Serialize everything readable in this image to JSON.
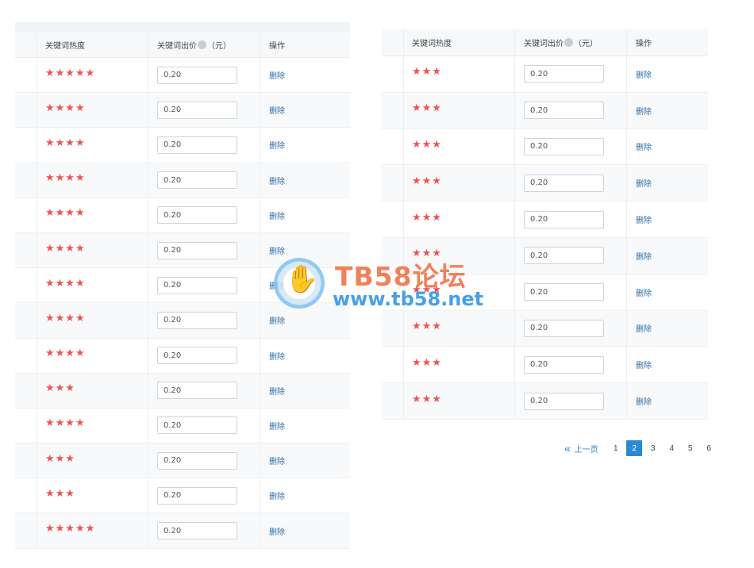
{
  "left_table": {
    "headers": {
      "heat": "关键词热度",
      "price": "关键词出价",
      "price_unit": "（元）",
      "action": "操作"
    },
    "rows": [
      {
        "stars": "★★★★★",
        "price": "0.20",
        "action": "删除"
      },
      {
        "stars": "★★★★",
        "price": "0.20",
        "action": "删除"
      },
      {
        "stars": "★★★★",
        "price": "0.20",
        "action": "删除"
      },
      {
        "stars": "★★★★",
        "price": "0.20",
        "action": "删除"
      },
      {
        "stars": "★★★★",
        "price": "0.20",
        "action": "删除"
      },
      {
        "stars": "★★★★",
        "price": "0.20",
        "action": "删除"
      },
      {
        "stars": "★★★★",
        "price": "0.20",
        "action": "删除"
      },
      {
        "stars": "★★★★",
        "price": "0.20",
        "action": "删除"
      },
      {
        "stars": "★★★★",
        "price": "0.20",
        "action": "删除"
      },
      {
        "stars": "★★★",
        "price": "0.20",
        "action": "删除"
      },
      {
        "stars": "★★★★",
        "price": "0.20",
        "action": "删除"
      },
      {
        "stars": "★★★",
        "price": "0.20",
        "action": "删除"
      },
      {
        "stars": "★★★",
        "price": "0.20",
        "action": "删除"
      },
      {
        "stars": "★★★★★",
        "price": "0.20",
        "action": "删除"
      }
    ]
  },
  "right_table": {
    "headers": {
      "heat": "关键词热度",
      "price": "关键词出价",
      "price_unit": "（元）",
      "action": "操作"
    },
    "rows": [
      {
        "stars": "★★★",
        "price": "0.20",
        "action": "删除"
      },
      {
        "stars": "★★★",
        "price": "0.20",
        "action": "删除"
      },
      {
        "stars": "★★★",
        "price": "0.20",
        "action": "删除"
      },
      {
        "stars": "★★★",
        "price": "0.20",
        "action": "删除"
      },
      {
        "stars": "★★★",
        "price": "0.20",
        "action": "删除"
      },
      {
        "stars": "★★★",
        "price": "0.20",
        "action": "删除"
      },
      {
        "stars": "★★★",
        "price": "0.20",
        "action": "删除"
      },
      {
        "stars": "★★★",
        "price": "0.20",
        "action": "删除"
      },
      {
        "stars": "★★★",
        "price": "0.20",
        "action": "删除"
      },
      {
        "stars": "★★★",
        "price": "0.20",
        "action": "删除"
      }
    ]
  },
  "pagination": {
    "prev_label": "上一页",
    "pages": [
      "1",
      "2",
      "3",
      "4",
      "5",
      "6"
    ],
    "current": "2"
  },
  "watermark": {
    "title": "TB58论坛",
    "url": "www.tb58.net"
  },
  "colors": {
    "star": "#ee5452",
    "link": "#2d6fa8",
    "active_page": "#2d88d3"
  }
}
